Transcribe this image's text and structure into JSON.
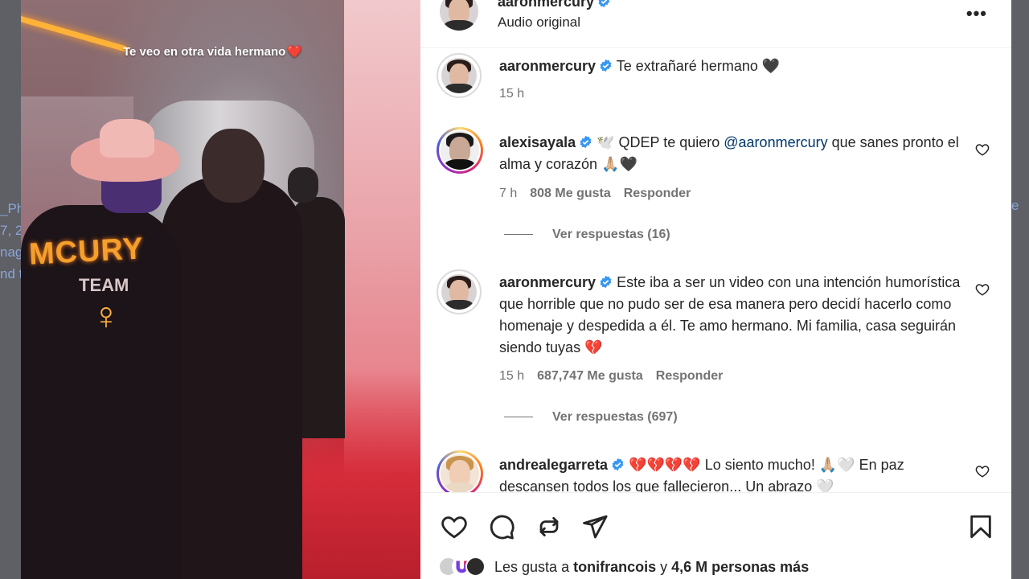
{
  "backdrop": {
    "left_fragments": [
      "_Ph",
      "7, 2",
      "nag",
      "nd t"
    ],
    "right_fragment": "e"
  },
  "media": {
    "caption": "Te veo en otra vida hermano",
    "caption_emoji": "❤️",
    "jacket_text": "MCURY",
    "jacket_team": "TEAM",
    "symbol": "♀"
  },
  "header": {
    "username": "aaronmercury",
    "audio": "Audio original",
    "more": "•••"
  },
  "caption_comment": {
    "username": "aaronmercury",
    "text": "Te extrañaré hermano 🖤",
    "time": "15 h"
  },
  "comments": [
    {
      "username": "alexisayala",
      "text_before": "🕊️ QDEP te quiero ",
      "mention": "@aaronmercury",
      "text_after": " que sanes pronto el alma y corazón 🙏🏼🖤",
      "time": "7 h",
      "likes": "808 Me gusta",
      "reply": "Responder",
      "view_replies": "Ver respuestas (16)"
    },
    {
      "username": "aaronmercury",
      "text": "Este iba a ser un video con una intención humorística que horrible que no pudo ser de esa manera pero decidí hacerlo como homenaje y despedida a él. Te amo hermano. Mi familia, casa seguirán siendo tuyas 💔",
      "time": "15 h",
      "likes": "687,747 Me gusta",
      "reply": "Responder",
      "view_replies": "Ver respuestas (697)"
    },
    {
      "username": "andrealegarreta",
      "text": "💔💔💔💔 Lo siento mucho! 🙏🏼🤍 En paz descansen todos los que fallecieron... Un abrazo 🤍"
    }
  ],
  "likes_summary": {
    "prefix": "Les gusta a ",
    "user": "tonifrancois",
    "middle": " y ",
    "rest": "4,6 M personas más"
  },
  "colors": {
    "verified": "#3897f0",
    "mention": "#00376b",
    "secondary_text": "#737373"
  }
}
